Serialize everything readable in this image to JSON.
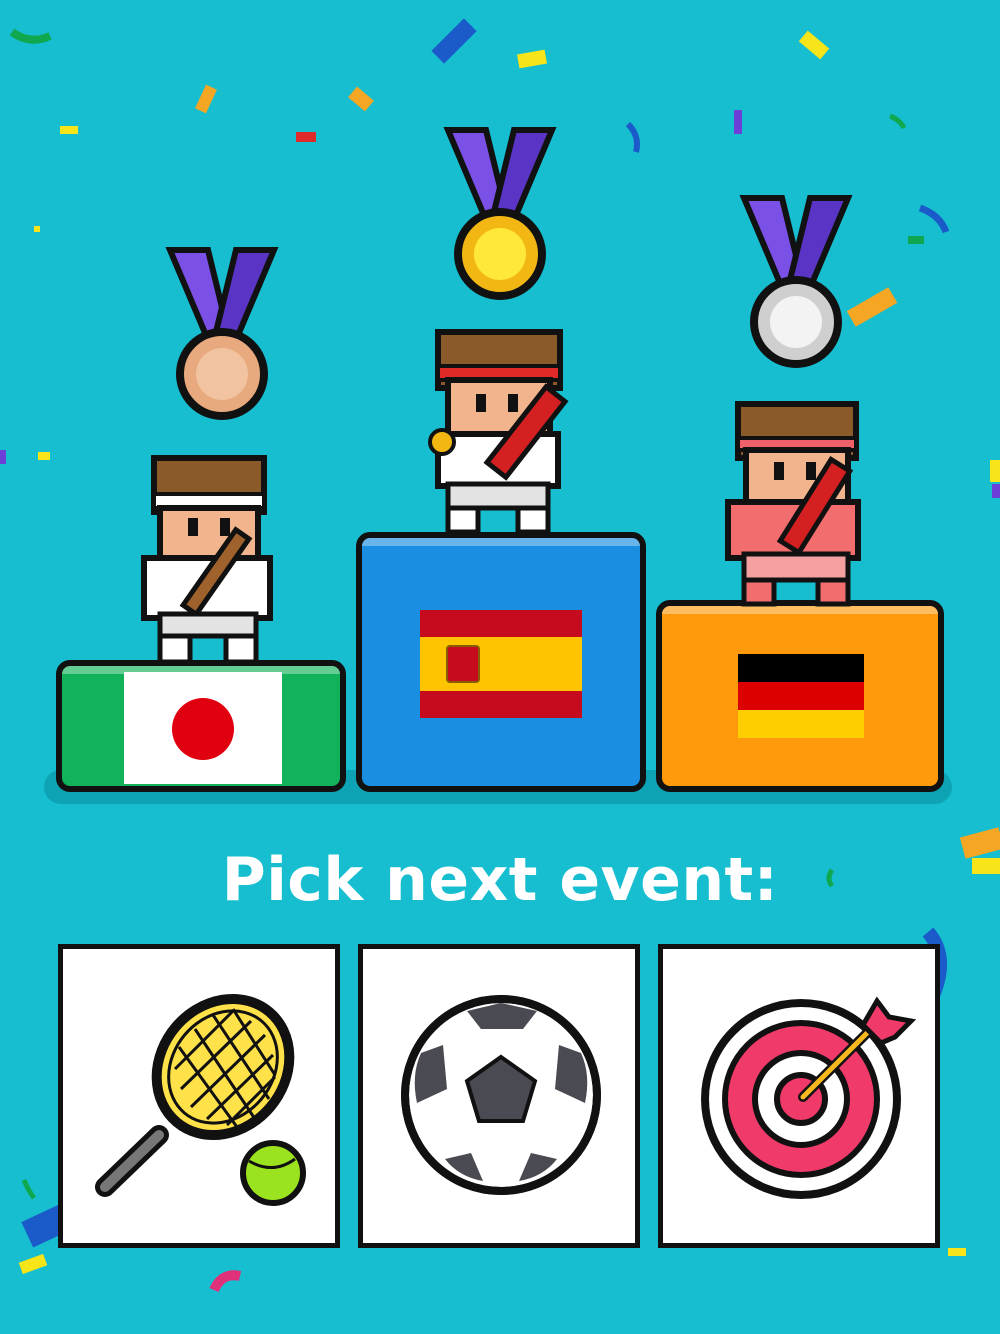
{
  "prompt": "Pick next event:",
  "podium": [
    {
      "place": 3,
      "country": "Japan",
      "medal": "bronze",
      "color": "#11B25A",
      "medal_color": "#E8A97E"
    },
    {
      "place": 1,
      "country": "Spain",
      "medal": "gold",
      "color": "#1A8EE0",
      "medal_color": "#F7D21C"
    },
    {
      "place": 2,
      "country": "Germany",
      "medal": "silver",
      "color": "#FF9A0D",
      "medal_color": "#E8E8E8"
    }
  ],
  "events": [
    {
      "name": "tennis",
      "icon": "tennis-racket-icon"
    },
    {
      "name": "football",
      "icon": "soccer-ball-icon"
    },
    {
      "name": "archery",
      "icon": "archery-target-icon"
    }
  ],
  "colors": {
    "background": "#17BED0",
    "ribbon": "#7B50E6",
    "outline": "#111111"
  }
}
